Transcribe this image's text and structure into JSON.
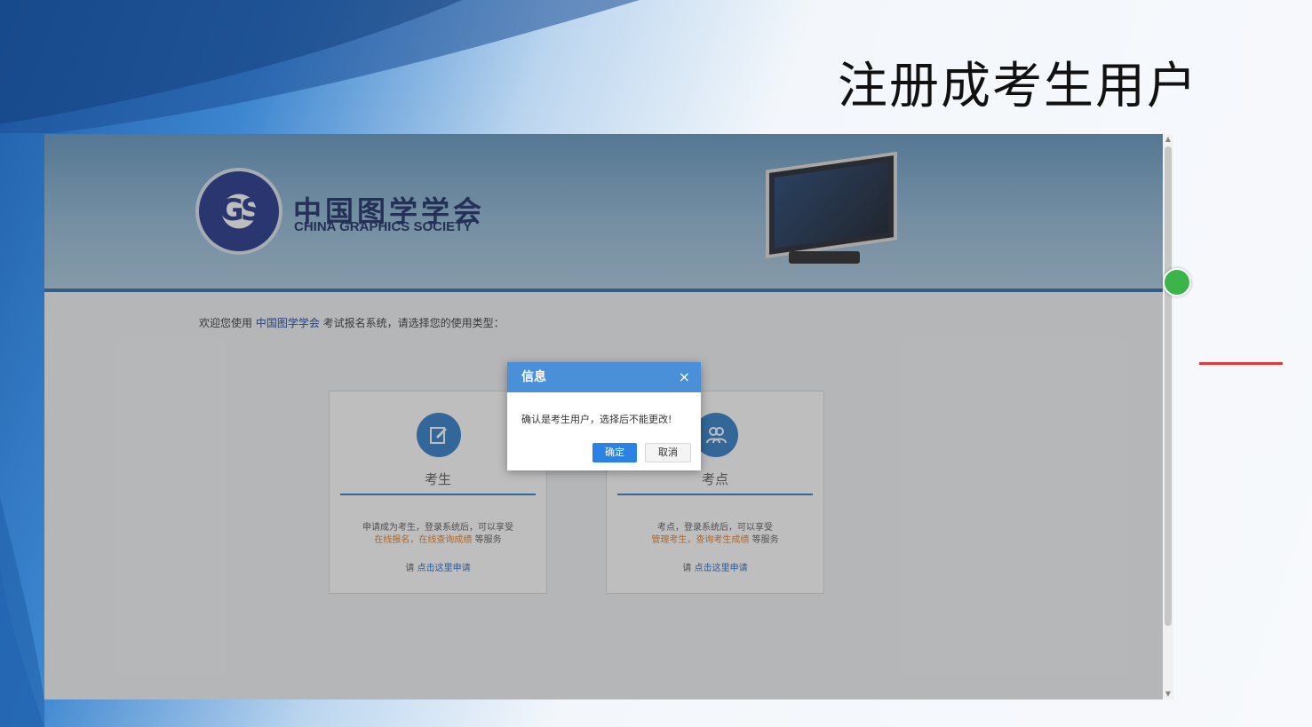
{
  "slide": {
    "title": "注册成考生用户"
  },
  "site": {
    "logo_cn": "中国图学学会",
    "logo_en": "CHINA GRAPHICS SOCIETY"
  },
  "welcome": {
    "prefix": "欢迎您使用 ",
    "org": "中国图学学会",
    "suffix": " 考试报名系统，请选择您的使用类型："
  },
  "cards": [
    {
      "title": "考生",
      "desc_line1": "申请成为考生，登录系统后，可以享受",
      "desc_highlight": "在线报名，在线查询成绩",
      "desc_tail": " 等服务",
      "apply_prefix": "请 ",
      "apply_link": "点击这里申请"
    },
    {
      "title": "考点",
      "desc_line1": "考点，登录系统后，可以享受",
      "desc_highlight": "管理考生，查询考生成绩",
      "desc_tail": " 等服务",
      "apply_prefix": "请 ",
      "apply_link": "点击这里申请"
    }
  ],
  "dialog": {
    "title": "信息",
    "close": "×",
    "message": "确认是考生用户，选择后不能更改!",
    "ok": "确定",
    "cancel": "取消"
  },
  "colors": {
    "accent": "#2a82e4",
    "dialog_header": "#4a90d9",
    "highlight": "#e07a1c",
    "marker": "#e03a3a"
  }
}
